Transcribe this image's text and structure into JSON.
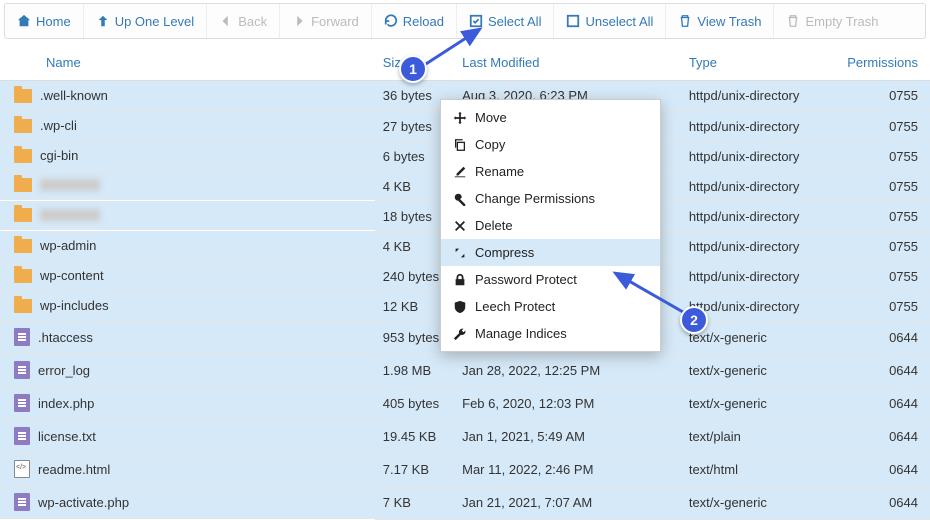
{
  "toolbar": {
    "home": "Home",
    "up": "Up One Level",
    "back": "Back",
    "forward": "Forward",
    "reload": "Reload",
    "select_all": "Select All",
    "unselect_all": "Unselect All",
    "view_trash": "View Trash",
    "empty_trash": "Empty Trash"
  },
  "columns": {
    "name": "Name",
    "size": "Size",
    "modified": "Last Modified",
    "type": "Type",
    "permissions": "Permissions"
  },
  "rows": [
    {
      "icon": "folder",
      "name": ".well-known",
      "size": "36 bytes",
      "modified": "Aug 3, 2020, 6:23 PM",
      "type": "httpd/unix-directory",
      "perm": "0755",
      "selected": true
    },
    {
      "icon": "folder",
      "name": ".wp-cli",
      "size": "27 bytes",
      "modified": "",
      "type": "httpd/unix-directory",
      "perm": "0755",
      "selected": true
    },
    {
      "icon": "folder",
      "name": "cgi-bin",
      "size": "6 bytes",
      "modified": "",
      "type": "httpd/unix-directory",
      "perm": "0755",
      "selected": true
    },
    {
      "icon": "folder",
      "name": "",
      "blurred": true,
      "size": "4 KB",
      "modified": "",
      "type": "httpd/unix-directory",
      "perm": "0755",
      "selected": true
    },
    {
      "icon": "folder",
      "name": "",
      "blurred": true,
      "size": "18 bytes",
      "modified": "",
      "type": "httpd/unix-directory",
      "perm": "0755",
      "selected": true
    },
    {
      "icon": "folder",
      "name": "wp-admin",
      "size": "4 KB",
      "modified": "",
      "type": "httpd/unix-directory",
      "perm": "0755",
      "selected": true
    },
    {
      "icon": "folder",
      "name": "wp-content",
      "size": "240 bytes",
      "modified": "",
      "type": "httpd/unix-directory",
      "perm": "0755",
      "selected": true
    },
    {
      "icon": "folder",
      "name": "wp-includes",
      "size": "12 KB",
      "modified": "",
      "type": "httpd/unix-directory",
      "perm": "0755",
      "selected": true
    },
    {
      "icon": "file",
      "name": ".htaccess",
      "size": "953 bytes",
      "modified": "",
      "type": "text/x-generic",
      "perm": "0644",
      "selected": true
    },
    {
      "icon": "file",
      "name": "error_log",
      "size": "1.98 MB",
      "modified": "Jan 28, 2022, 12:25 PM",
      "type": "text/x-generic",
      "perm": "0644",
      "selected": true
    },
    {
      "icon": "file",
      "name": "index.php",
      "size": "405 bytes",
      "modified": "Feb 6, 2020, 12:03 PM",
      "type": "text/x-generic",
      "perm": "0644",
      "selected": true
    },
    {
      "icon": "file",
      "name": "license.txt",
      "size": "19.45 KB",
      "modified": "Jan 1, 2021, 5:49 AM",
      "type": "text/plain",
      "perm": "0644",
      "selected": true
    },
    {
      "icon": "html",
      "name": "readme.html",
      "size": "7.17 KB",
      "modified": "Mar 11, 2022, 2:46 PM",
      "type": "text/html",
      "perm": "0644",
      "selected": true
    },
    {
      "icon": "file",
      "name": "wp-activate.php",
      "size": "7 KB",
      "modified": "Jan 21, 2021, 7:07 AM",
      "type": "text/x-generic",
      "perm": "0644",
      "selected": true
    }
  ],
  "context_menu": {
    "items": [
      {
        "icon": "move",
        "label": "Move"
      },
      {
        "icon": "copy",
        "label": "Copy"
      },
      {
        "icon": "rename",
        "label": "Rename"
      },
      {
        "icon": "perms",
        "label": "Change Permissions"
      },
      {
        "icon": "delete",
        "label": "Delete"
      },
      {
        "icon": "compress",
        "label": "Compress",
        "highlight": true
      },
      {
        "icon": "lock",
        "label": "Password Protect"
      },
      {
        "icon": "shield",
        "label": "Leech Protect"
      },
      {
        "icon": "wrench",
        "label": "Manage Indices"
      }
    ]
  },
  "badges": {
    "one": "1",
    "two": "2"
  }
}
